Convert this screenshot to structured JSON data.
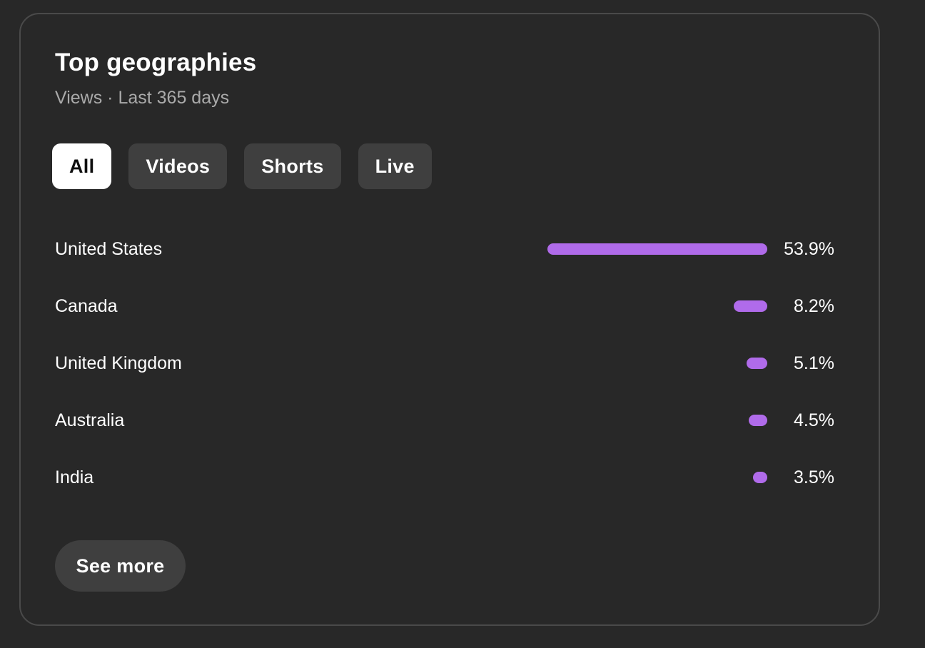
{
  "card": {
    "title": "Top geographies",
    "subtitle": "Views · Last 365 days"
  },
  "filters": {
    "selected": "All",
    "chips": [
      {
        "label": "All"
      },
      {
        "label": "Videos"
      },
      {
        "label": "Shorts"
      },
      {
        "label": "Live"
      }
    ]
  },
  "accent_color": "#b06bea",
  "rows": [
    {
      "country": "United States",
      "percent_label": "53.9%",
      "share": 53.9
    },
    {
      "country": "Canada",
      "percent_label": "8.2%",
      "share": 8.2
    },
    {
      "country": "United Kingdom",
      "percent_label": "5.1%",
      "share": 5.1
    },
    {
      "country": "Australia",
      "percent_label": "4.5%",
      "share": 4.5
    },
    {
      "country": "India",
      "percent_label": "3.5%",
      "share": 3.5
    }
  ],
  "footer": {
    "see_more_label": "See more"
  }
}
